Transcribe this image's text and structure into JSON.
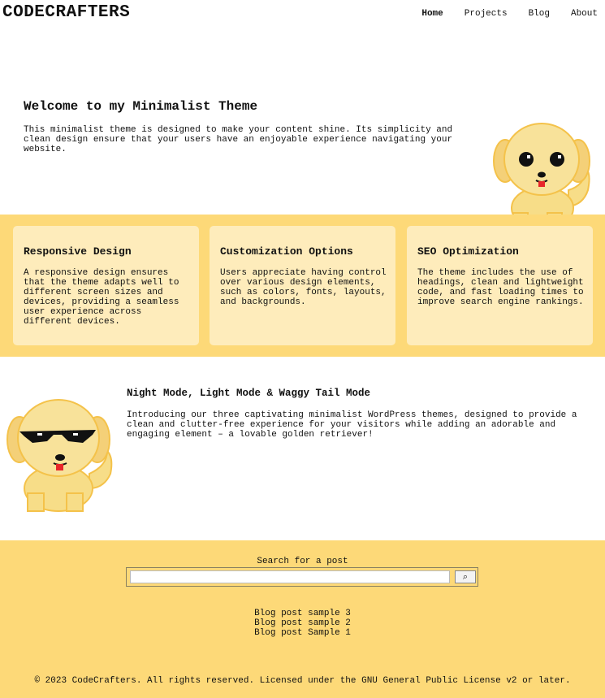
{
  "header": {
    "logo": "CODECRAFTERS",
    "nav": [
      "Home",
      "Projects",
      "Blog",
      "About"
    ]
  },
  "hero": {
    "title": "Welcome to my Minimalist Theme",
    "text": "This minimalist theme is designed to make your content shine. Its simplicity and clean design ensure that your users have an enjoyable experience navigating your website."
  },
  "features": [
    {
      "title": "Responsive Design",
      "text": "A responsive design ensures that the theme adapts well to different screen sizes and devices, providing a seamless user experience across different devices."
    },
    {
      "title": "Customization Options",
      "text": "Users appreciate having control over various design elements, such as colors, fonts, layouts, and backgrounds."
    },
    {
      "title": "SEO Optimization",
      "text": "The theme includes the use of headings, clean and lightweight code, and fast loading times to improve search engine rankings."
    }
  ],
  "modes": {
    "title": "Night Mode, Light Mode & Waggy Tail Mode",
    "text": "Introducing our three captivating minimalist WordPress themes, designed to provide a clean and clutter-free experience for your visitors while adding an adorable and engaging element – a lovable golden retriever!"
  },
  "footer": {
    "search_label": "Search for a post",
    "search_value": "",
    "search_button_icon": "search-icon",
    "posts": [
      "Blog post sample 3",
      "Blog post sample 2",
      "Blog post Sample 1"
    ],
    "copyright": "© 2023 CodeCrafters. All rights reserved. Licensed under the GNU General Public License v2 or later."
  },
  "colors": {
    "accent": "#fdd978",
    "card": "#feecbb",
    "dog_fur": "#f7dd88",
    "dog_outline": "#f4c24a"
  }
}
